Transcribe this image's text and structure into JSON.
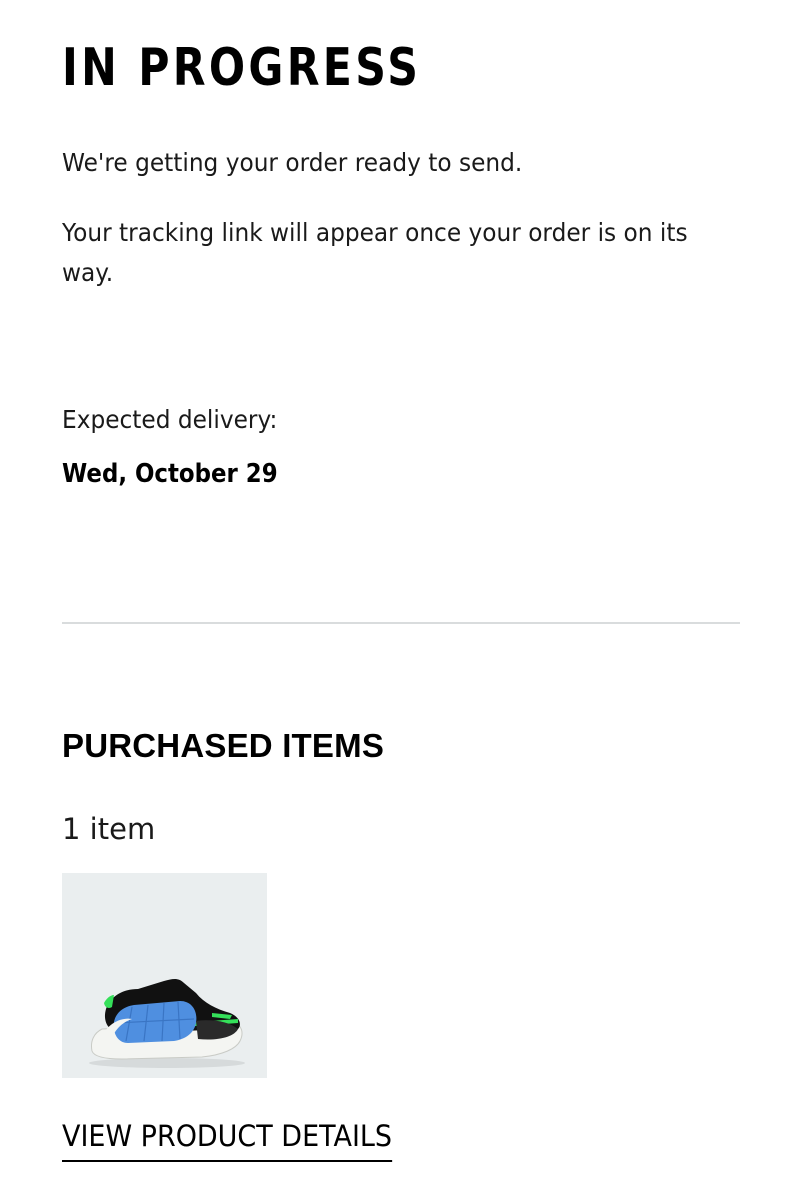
{
  "order_status": {
    "title": "IN PROGRESS",
    "message_1": "We're getting your order ready to send.",
    "message_2": "Your tracking link will appear once your order is on its way.",
    "delivery_label": "Expected delivery:",
    "delivery_date": "Wed, October 29"
  },
  "purchased_items": {
    "title": "PURCHASED ITEMS",
    "count_label": "1 item",
    "items": [
      {
        "image": "basketball-shoe-blue-black-green",
        "link_label": "VIEW PRODUCT DETAILS"
      }
    ]
  },
  "colors": {
    "text": "#000000",
    "divider": "#d9dcdd",
    "thumb_background": "#eaeeef",
    "shoe_upper": "#4f8fe0",
    "shoe_accent": "#35e05a",
    "shoe_collar": "#111111"
  }
}
